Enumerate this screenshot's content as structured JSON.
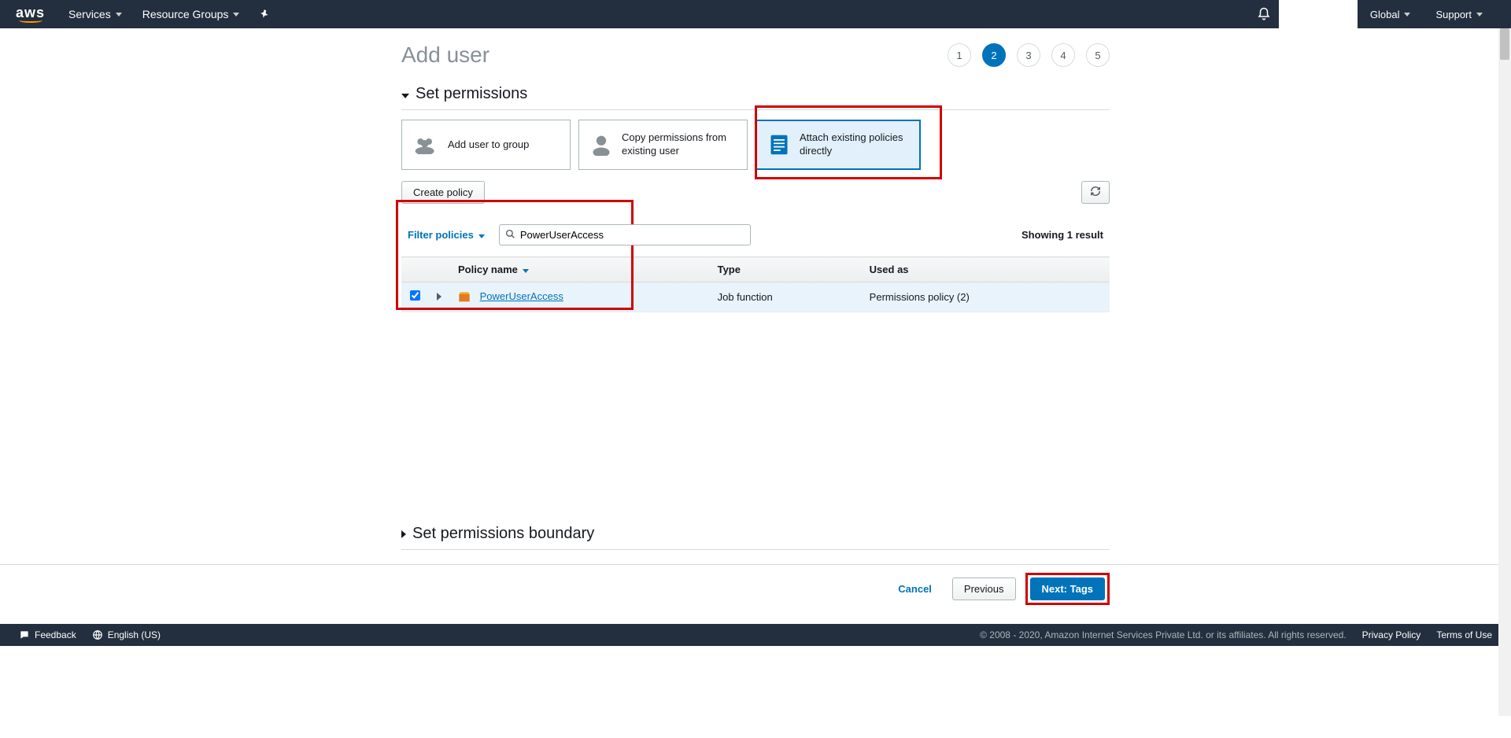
{
  "nav": {
    "logo": "aws",
    "services": "Services",
    "resource_groups": "Resource Groups",
    "global": "Global",
    "support": "Support"
  },
  "page": {
    "title": "Add user",
    "steps": [
      "1",
      "2",
      "3",
      "4",
      "5"
    ],
    "active_step": 2,
    "set_permissions": "Set permissions",
    "boundary": "Set permissions boundary"
  },
  "cards": {
    "add_group": "Add user to group",
    "copy_user": "Copy permissions from existing user",
    "attach": "Attach existing policies directly"
  },
  "toolbar": {
    "create_policy": "Create policy"
  },
  "filter": {
    "label": "Filter policies",
    "search_value": "PowerUserAccess",
    "result": "Showing 1 result"
  },
  "table": {
    "col_policy": "Policy name",
    "col_type": "Type",
    "col_used": "Used as",
    "rows": [
      {
        "name": "PowerUserAccess",
        "type": "Job function",
        "used": "Permissions policy (2)",
        "checked": true
      }
    ]
  },
  "wizard": {
    "cancel": "Cancel",
    "previous": "Previous",
    "next": "Next: Tags"
  },
  "footer": {
    "feedback": "Feedback",
    "lang": "English (US)",
    "copyright": "© 2008 - 2020, Amazon Internet Services Private Ltd. or its affiliates. All rights reserved.",
    "privacy": "Privacy Policy",
    "terms": "Terms of Use"
  }
}
